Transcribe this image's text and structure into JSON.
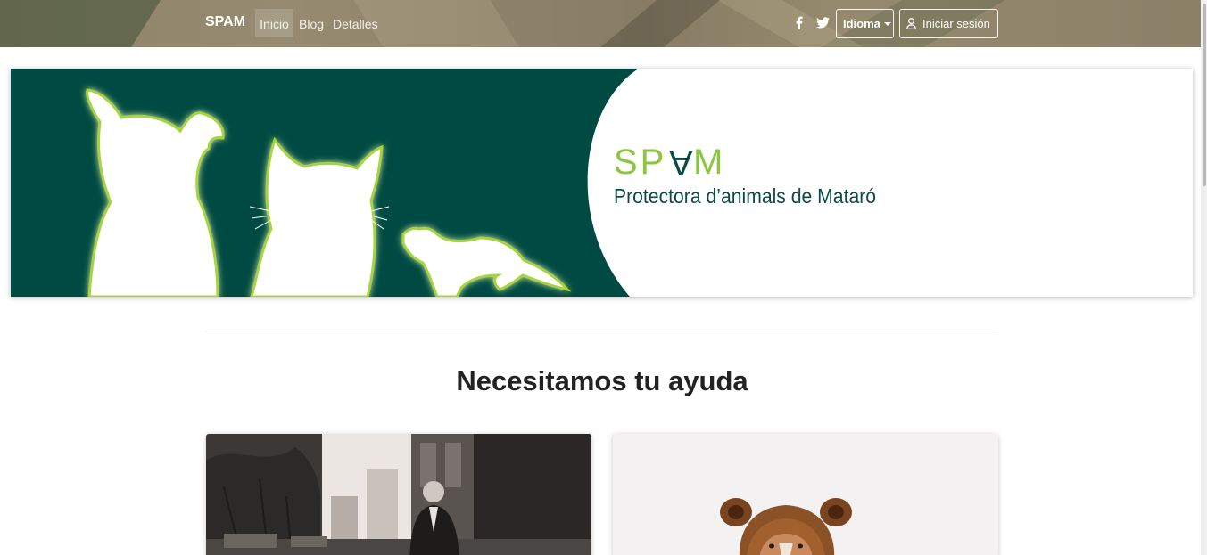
{
  "navbar": {
    "brand": "SPAM",
    "links": [
      {
        "label": "Inicio",
        "active": true
      },
      {
        "label": "Blog",
        "active": false
      },
      {
        "label": "Detalles",
        "active": false
      }
    ],
    "social_icons": [
      "facebook-icon",
      "twitter-icon"
    ],
    "language_dropdown_label": "Idioma",
    "login_label": "Iniciar sesión",
    "login_icon": "user-icon"
  },
  "banner": {
    "logo_title": "SPAM",
    "logo_subtitle": "Protectora d’animals  de Mataró",
    "colors": {
      "dark_green": "#004a44",
      "light_green": "#8cc63e",
      "text_green": "#0c4b43"
    }
  },
  "section": {
    "title": "Necesitamos tu ayuda"
  }
}
